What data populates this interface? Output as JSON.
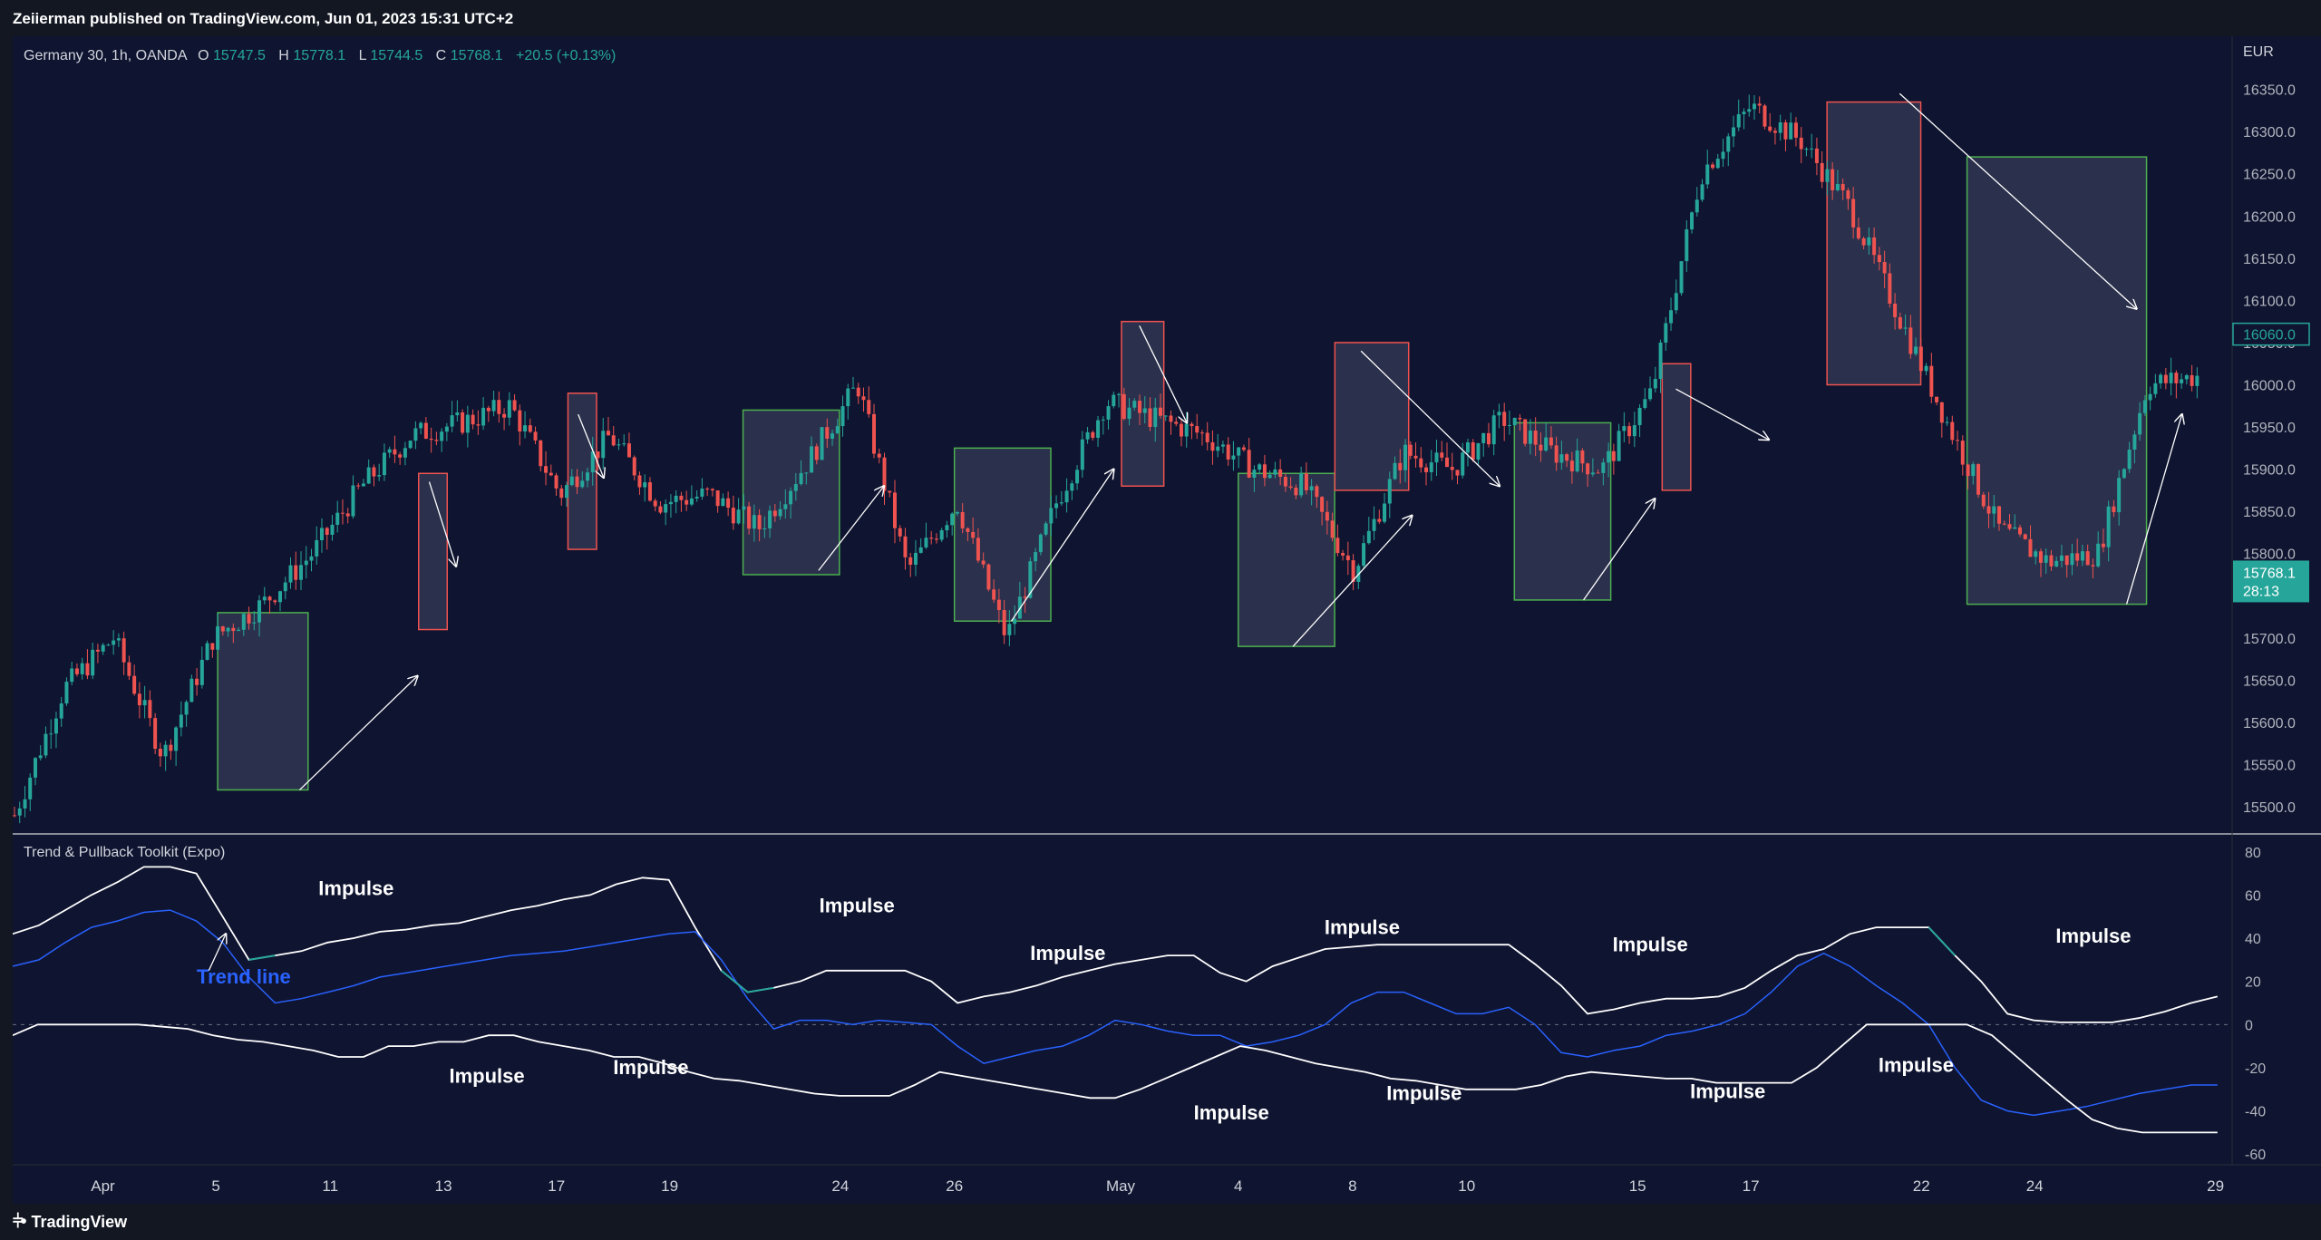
{
  "header": {
    "published": "Zeiierman published on TradingView.com, Jun 01, 2023 15:31 UTC+2"
  },
  "legend": {
    "symbol": "Germany 30, 1h, OANDA",
    "open_label": "O",
    "open": "15747.5",
    "high_label": "H",
    "high": "15778.1",
    "low_label": "L",
    "low": "15744.5",
    "close_label": "C",
    "close": "15768.1",
    "change": "+20.5 (+0.13%)"
  },
  "price_axis": {
    "currency": "EUR",
    "ticks": [
      "16350.0",
      "16300.0",
      "16250.0",
      "16200.0",
      "16150.0",
      "16100.0",
      "16050.0",
      "16000.0",
      "15950.0",
      "15900.0",
      "15850.0",
      "15800.0",
      "15750.0",
      "15700.0",
      "15650.0",
      "15600.0",
      "15550.0",
      "15500.0"
    ],
    "tag_level": "16060.0",
    "last_price": "15768.1",
    "countdown": "28:13"
  },
  "time_axis": {
    "ticks": [
      "Apr",
      "5",
      "11",
      "13",
      "17",
      "19",
      "24",
      "26",
      "May",
      "4",
      "8",
      "10",
      "15",
      "17",
      "22",
      "24",
      "29"
    ]
  },
  "indicator": {
    "title": "Trend & Pullback Toolkit (Expo)",
    "ticks": [
      "80",
      "60",
      "40",
      "20",
      "0",
      "-20",
      "-40",
      "-60"
    ],
    "impulse_label": "Impulse",
    "trend_label": "Trend line"
  },
  "footer": {
    "brand": "TradingView"
  },
  "colors": {
    "background": "#0f1430",
    "up_candle": "#26a69a",
    "down_candle": "#ef5350",
    "green_box": "#4caf50",
    "red_box": "#ef5350",
    "trend_line": "#2962ff",
    "band_line": "#ffffff",
    "impulse_up": "#26a69a",
    "impulse_down": "#ef5350"
  },
  "chart_data": [
    {
      "type": "line",
      "title": "Germany 30, 1h, OANDA",
      "ylabel": "EUR",
      "ylim": [
        15470,
        16370
      ],
      "x": [
        "Apr",
        "5",
        "11",
        "13",
        "17",
        "19",
        "24",
        "26",
        "May",
        "4",
        "8",
        "10",
        "15",
        "17",
        "22",
        "24",
        "29"
      ],
      "series": [
        {
          "values": [
            15490,
            15640,
            15700,
            15560,
            15700,
            15740,
            15800,
            15880,
            15940,
            15955,
            15975,
            15870,
            15940,
            15860,
            15870,
            15830,
            15910,
            16000,
            15780,
            15860,
            15700,
            15860,
            15980,
            15960,
            15940,
            15900,
            15880,
            15780,
            15920,
            15900,
            15960,
            15920,
            15900,
            15990,
            16250,
            16330,
            16290,
            16210,
            16080,
            15950,
            15830,
            15790,
            15800,
            16000,
            16010
          ]
        }
      ],
      "annotations": {
        "boxes": [
          {
            "x0": 0.0925,
            "x1": 0.1333,
            "y0": 15520,
            "y1": 15730,
            "color": "green"
          },
          {
            "x0": 0.1832,
            "x1": 0.1961,
            "y0": 15710,
            "y1": 15895,
            "color": "red"
          },
          {
            "x0": 0.2506,
            "x1": 0.2635,
            "y0": 15805,
            "y1": 15990,
            "color": "red"
          },
          {
            "x0": 0.3296,
            "x1": 0.3731,
            "y0": 15775,
            "y1": 15970,
            "color": "green"
          },
          {
            "x0": 0.425,
            "x1": 0.4685,
            "y0": 15720,
            "y1": 15925,
            "color": "green"
          },
          {
            "x0": 0.5004,
            "x1": 0.5195,
            "y0": 15880,
            "y1": 16075,
            "color": "red"
          },
          {
            "x0": 0.5531,
            "x1": 0.5966,
            "y0": 15690,
            "y1": 15895,
            "color": "green"
          },
          {
            "x0": 0.5967,
            "x1": 0.63,
            "y0": 15875,
            "y1": 16050,
            "color": "red"
          },
          {
            "x0": 0.6777,
            "x1": 0.7212,
            "y0": 15745,
            "y1": 15955,
            "color": "green"
          },
          {
            "x0": 0.7444,
            "x1": 0.7573,
            "y0": 15875,
            "y1": 16025,
            "color": "red"
          },
          {
            "x0": 0.8188,
            "x1": 0.8611,
            "y0": 16000,
            "y1": 16335,
            "color": "red"
          },
          {
            "x0": 0.882,
            "x1": 0.963,
            "y0": 15740,
            "y1": 16270,
            "color": "green"
          }
        ],
        "arrows": [
          {
            "x0": 0.1295,
            "y0": 15520,
            "x1": 0.1827,
            "y1": 15655
          },
          {
            "x0": 0.188,
            "y0": 15885,
            "x1": 0.2001,
            "y1": 15785
          },
          {
            "x0": 0.2552,
            "y0": 15965,
            "x1": 0.2667,
            "y1": 15890
          },
          {
            "x0": 0.3637,
            "y0": 15780,
            "x1": 0.3932,
            "y1": 15880
          },
          {
            "x0": 0.4507,
            "y0": 15720,
            "x1": 0.4969,
            "y1": 15900
          },
          {
            "x0": 0.5085,
            "y0": 16070,
            "x1": 0.5299,
            "y1": 15955
          },
          {
            "x0": 0.5778,
            "y0": 15690,
            "x1": 0.6315,
            "y1": 15845
          },
          {
            "x0": 0.6085,
            "y0": 16040,
            "x1": 0.671,
            "y1": 15880
          },
          {
            "x0": 0.7089,
            "y0": 15745,
            "x1": 0.7411,
            "y1": 15865
          },
          {
            "x0": 0.7506,
            "y0": 15995,
            "x1": 0.7925,
            "y1": 15935
          },
          {
            "x0": 0.8516,
            "y0": 16345,
            "x1": 0.9585,
            "y1": 16090
          },
          {
            "x0": 0.954,
            "y0": 15740,
            "x1": 0.979,
            "y1": 15965
          }
        ]
      }
    },
    {
      "type": "line",
      "title": "Trend & Pullback Toolkit (Expo)",
      "ylim": [
        -62,
        82
      ],
      "x": [
        "Apr",
        "5",
        "11",
        "13",
        "17",
        "19",
        "24",
        "26",
        "May",
        "4",
        "8",
        "10",
        "15",
        "17",
        "22",
        "24",
        "29"
      ],
      "series": [
        {
          "values": [
            42,
            46,
            53,
            60,
            66,
            73,
            73,
            70,
            50,
            30,
            32,
            34,
            38,
            40,
            43,
            44,
            46,
            47,
            50,
            53,
            55,
            58,
            60,
            65,
            68,
            67,
            45,
            25,
            15,
            17,
            20,
            25,
            25,
            25,
            25,
            20,
            10,
            13,
            15,
            18,
            22,
            25,
            28,
            30,
            32,
            32,
            24,
            20,
            27,
            31,
            35,
            36,
            37,
            37,
            37,
            37,
            37,
            37,
            28,
            18,
            5,
            7,
            10,
            12,
            12,
            13,
            17,
            25,
            32,
            35,
            42,
            45,
            45,
            45,
            32,
            20,
            5,
            2,
            1,
            1,
            1,
            3,
            6,
            10,
            13
          ]
        },
        {
          "values": [
            27,
            30,
            38,
            45,
            48,
            52,
            53,
            48,
            38,
            22,
            10,
            12,
            15,
            18,
            22,
            24,
            26,
            28,
            30,
            32,
            33,
            34,
            36,
            38,
            40,
            42,
            43,
            30,
            12,
            -2,
            2,
            2,
            0,
            2,
            1,
            0,
            -10,
            -18,
            -15,
            -12,
            -10,
            -5,
            2,
            0,
            -3,
            -5,
            -5,
            -10,
            -8,
            -5,
            0,
            10,
            15,
            15,
            10,
            5,
            5,
            8,
            0,
            -13,
            -15,
            -12,
            -10,
            -5,
            -3,
            0,
            5,
            15,
            27,
            33,
            27,
            18,
            10,
            0,
            -20,
            -35,
            -40,
            -42,
            -40,
            -38,
            -35,
            -32,
            -30,
            -28,
            -28
          ]
        },
        {
          "values": [
            -5,
            0,
            0,
            0,
            0,
            0,
            -1,
            -2,
            -5,
            -7,
            -8,
            -10,
            -12,
            -15,
            -15,
            -10,
            -10,
            -8,
            -8,
            -5,
            -5,
            -8,
            -10,
            -12,
            -15,
            -15,
            -18,
            -22,
            -25,
            -26,
            -28,
            -30,
            -32,
            -33,
            -33,
            -33,
            -28,
            -22,
            -24,
            -26,
            -28,
            -30,
            -32,
            -34,
            -34,
            -30,
            -25,
            -20,
            -15,
            -10,
            -12,
            -15,
            -18,
            -20,
            -22,
            -25,
            -26,
            -28,
            -30,
            -30,
            -30,
            -28,
            -24,
            -22,
            -23,
            -24,
            -25,
            -25,
            -27,
            -27,
            -27,
            -27,
            -20,
            -10,
            0,
            0,
            0,
            0,
            0,
            -5,
            -15,
            -25,
            -35,
            -44,
            -48,
            -50,
            -50,
            -50,
            -50
          ]
        }
      ],
      "annotations": {
        "impulse_up": [
          [
            0.0989,
            0.1257
          ],
          [
            0.318,
            0.3485
          ],
          [
            0.4275,
            0.4427
          ],
          [
            0.5578,
            0.5714
          ],
          [
            0.668,
            0.6822
          ],
          [
            0.864,
            0.8812
          ]
        ],
        "impulse_down": [
          [
            0.182,
            0.19
          ],
          [
            0.259,
            0.264
          ],
          [
            0.5004,
            0.509
          ],
          [
            0.57,
            0.579
          ],
          [
            0.6,
            0.61
          ],
          [
            0.748,
            0.752
          ],
          [
            0.827,
            0.84
          ]
        ],
        "impulse_text": [
          {
            "x": 0.138,
            "y": 60,
            "text": "Impulse"
          },
          {
            "x": 0.364,
            "y": 52,
            "text": "Impulse"
          },
          {
            "x": 0.4592,
            "y": 30,
            "text": "Impulse"
          },
          {
            "x": 0.592,
            "y": 42,
            "text": "Impulse"
          },
          {
            "x": 0.722,
            "y": 34,
            "text": "Impulse"
          },
          {
            "x": 0.922,
            "y": 38,
            "text": "Impulse"
          },
          {
            "x": 0.197,
            "y": -27,
            "text": "Impulse"
          },
          {
            "x": 0.271,
            "y": -23,
            "text": "Impulse"
          },
          {
            "x": 0.533,
            "y": -44,
            "text": "Impulse"
          },
          {
            "x": 0.62,
            "y": -35,
            "text": "Impulse"
          },
          {
            "x": 0.757,
            "y": -34,
            "text": "Impulse"
          },
          {
            "x": 0.842,
            "y": -22,
            "text": "Impulse"
          }
        ],
        "trend_text": {
          "x": 0.083,
          "y": 19,
          "text": "Trend line"
        }
      }
    }
  ]
}
